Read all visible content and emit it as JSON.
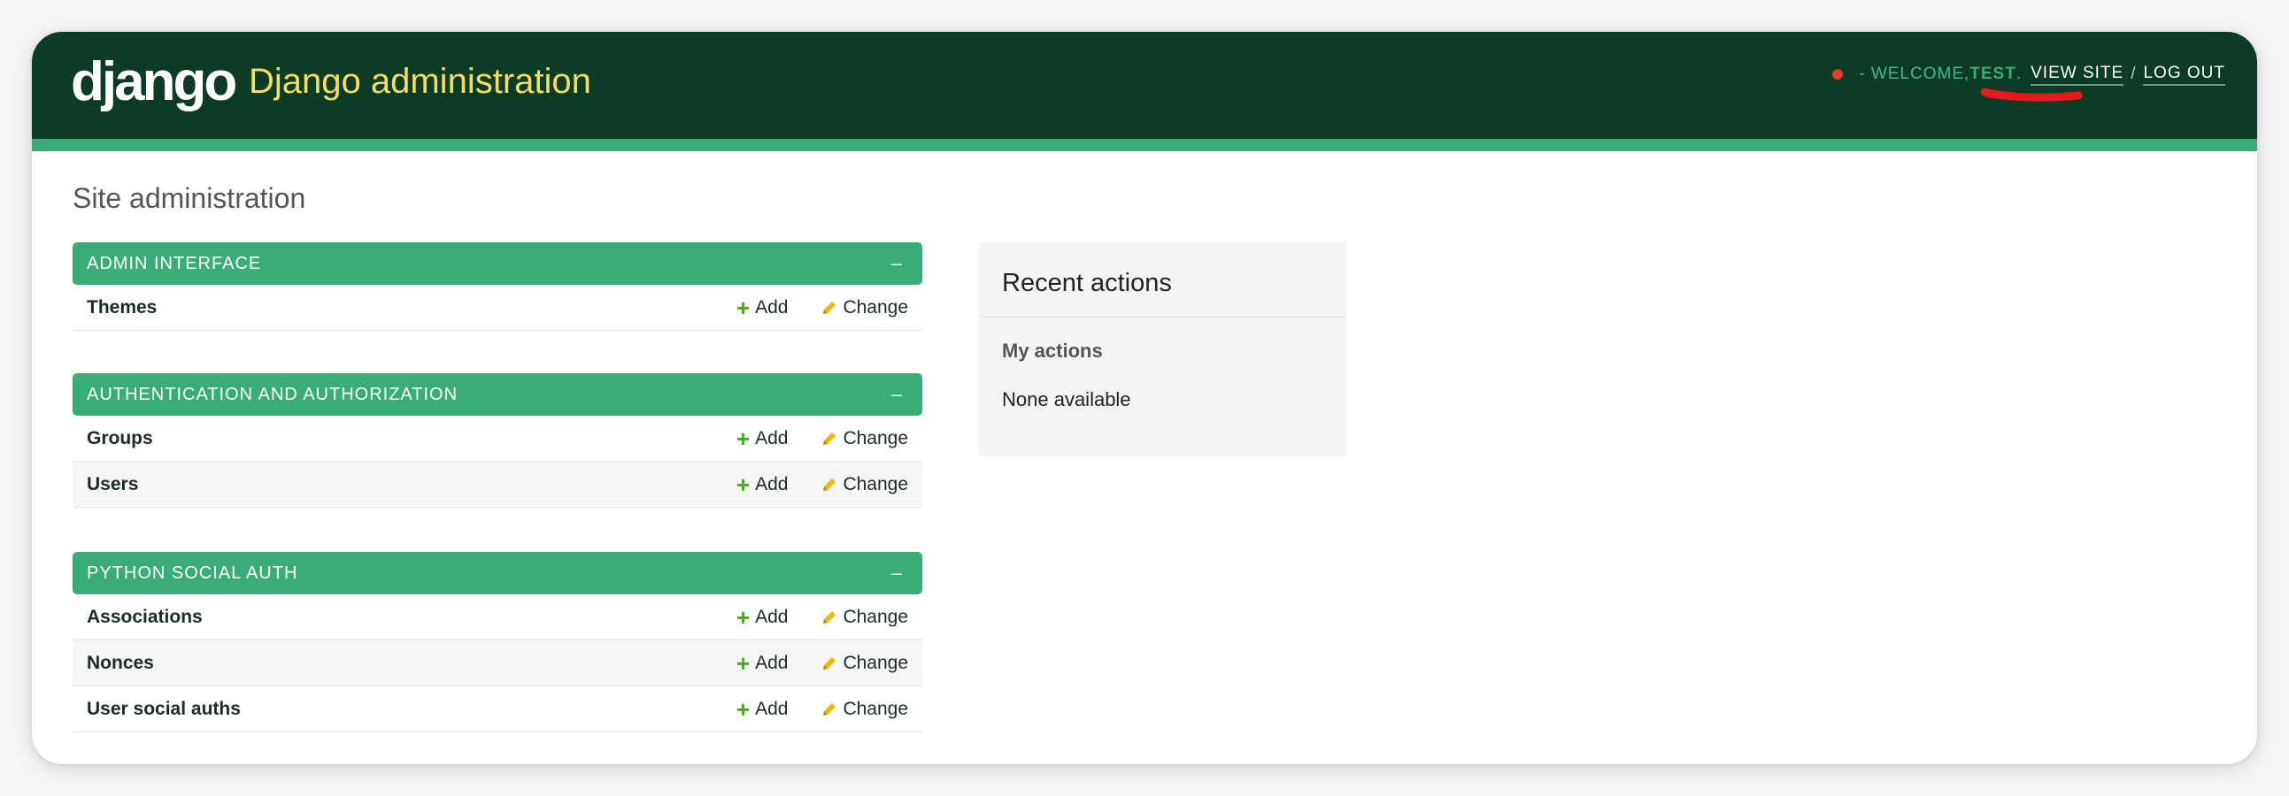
{
  "header": {
    "logo": "django",
    "site_title": "Django administration",
    "welcome_prefix": "- Welcome, ",
    "username": "test",
    "welcome_suffix": ".",
    "view_site": "View site",
    "separator": "/",
    "log_out": "Log out"
  },
  "page": {
    "title": "Site administration"
  },
  "modules": [
    {
      "name": "Admin Interface",
      "toggle": "–",
      "rows": [
        {
          "name": "Themes",
          "add": "Add",
          "change": "Change"
        }
      ]
    },
    {
      "name": "Authentication and Authorization",
      "toggle": "–",
      "rows": [
        {
          "name": "Groups",
          "add": "Add",
          "change": "Change"
        },
        {
          "name": "Users",
          "add": "Add",
          "change": "Change"
        }
      ]
    },
    {
      "name": "Python Social Auth",
      "toggle": "–",
      "rows": [
        {
          "name": "Associations",
          "add": "Add",
          "change": "Change"
        },
        {
          "name": "Nonces",
          "add": "Add",
          "change": "Change"
        },
        {
          "name": "User social auths",
          "add": "Add",
          "change": "Change"
        }
      ]
    }
  ],
  "recent_actions": {
    "title": "Recent actions",
    "subtitle": "My actions",
    "empty": "None available"
  },
  "icons": {
    "add": "plus-icon",
    "change": "pencil-icon",
    "status": "status-dot-icon"
  },
  "colors": {
    "header_bg": "#0c3c26",
    "accent": "#3aac78",
    "site_title": "#f5dd5d",
    "add_icon": "#4ca722",
    "change_icon": "#efb80b",
    "status_dot": "#e33a2c"
  }
}
